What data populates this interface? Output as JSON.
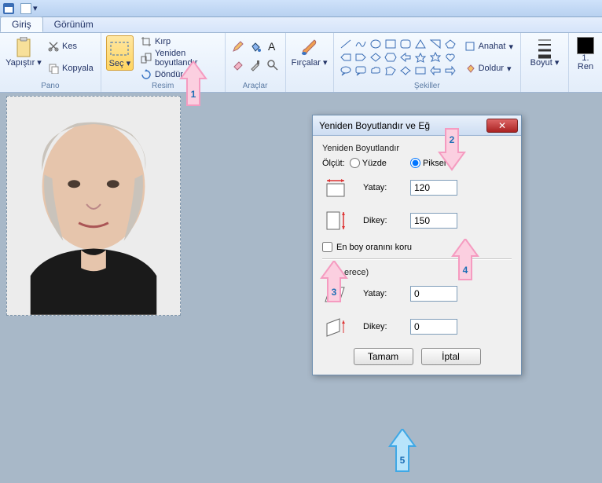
{
  "tabs": {
    "home": "Giriş",
    "view": "Görünüm"
  },
  "ribbon": {
    "pano": {
      "label": "Pano",
      "paste": "Yapıştır",
      "cut": "Kes",
      "copy": "Kopyala"
    },
    "resim": {
      "label": "Resim",
      "select": "Seç",
      "crop": "Kırp",
      "resize": "Yeniden boyutlandır",
      "rotate": "Döndür"
    },
    "araclar": {
      "label": "Araçlar"
    },
    "fircalar": {
      "label": "Fırçalar"
    },
    "sekiller": {
      "label": "Şekiller",
      "outline": "Anahat",
      "fill": "Doldur"
    },
    "boyut": {
      "label": "Boyut"
    },
    "renk": {
      "color1": "1.",
      "color1b": "Ren"
    }
  },
  "dlg": {
    "title": "Yeniden Boyutlandır ve Eğ",
    "resize_section": "Yeniden Boyutlandır",
    "by": "Ölçüt:",
    "percent": "Yüzde",
    "pixel": "Piksel",
    "horizontal": "Yatay:",
    "vertical": "Dikey:",
    "h_val": "120",
    "v_val": "150",
    "keep_ratio": "En boy oranını koru",
    "skew_section": "erece)",
    "sh_val": "0",
    "sv_val": "0",
    "ok": "Tamam",
    "cancel": "İptal"
  },
  "annotations": {
    "a1": "1",
    "a2": "2",
    "a3": "3",
    "a4": "4",
    "a5": "5"
  }
}
